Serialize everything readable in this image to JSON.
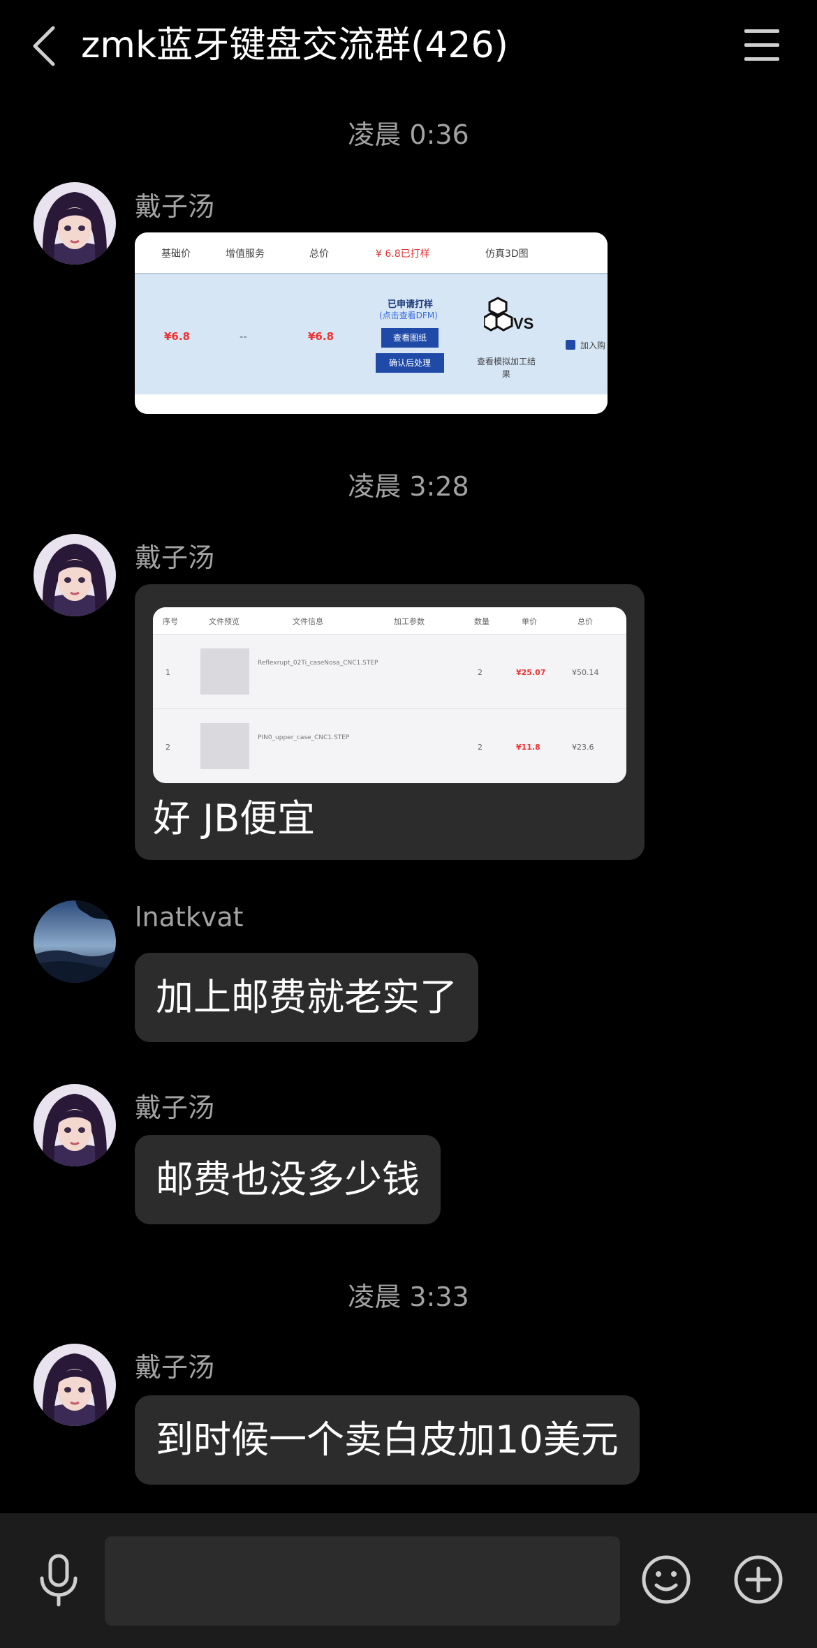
{
  "header": {
    "title": "zmk蓝牙键盘交流群(426)",
    "back_icon": "chevron-left-icon",
    "menu_icon": "hamburger-menu-icon"
  },
  "timestamps": [
    "凌晨 0:36",
    "凌晨 3:28",
    "凌晨 3:33"
  ],
  "messages": [
    {
      "sender": "戴子汤",
      "type": "image",
      "avatar": "anime-girl-avatar",
      "image_content": {
        "headers": [
          "基础价",
          "增值服务",
          "总价",
          "¥ 6.8已打样",
          "仿真3D图"
        ],
        "cells": [
          "¥6.8",
          "--",
          "¥6.8",
          "已申请打样",
          "(点击查看DFM)",
          "查看图纸",
          "确认后处理",
          "查看模拟加工结果",
          "加入购"
        ]
      }
    },
    {
      "sender": "戴子汤",
      "type": "image_with_text",
      "avatar": "anime-girl-avatar",
      "image_content": {
        "headers": [
          "序号",
          "文件预览",
          "文件信息",
          "加工参数",
          "数量",
          "单价",
          "总价"
        ],
        "rows": [
          {
            "no": "1",
            "file": "Reflexrupt_02Ti_caseNosa_CNC1.STEP",
            "qty": "2",
            "price": "¥25.07",
            "total": "¥50.14"
          },
          {
            "no": "2",
            "file": "PIN0_upper_case_CNC1.STEP",
            "qty": "2",
            "price": "¥11.8",
            "total": "¥23.6"
          }
        ]
      },
      "text": "好 JB便宜"
    },
    {
      "sender": "lnatkvat",
      "type": "text",
      "avatar": "landscape-avatar",
      "text": "加上邮费就老实了"
    },
    {
      "sender": "戴子汤",
      "type": "text",
      "avatar": "anime-girl-avatar",
      "text": "邮费也没多少钱"
    },
    {
      "sender": "戴子汤",
      "type": "text",
      "avatar": "anime-girl-avatar",
      "text": "到时候一个卖白皮加10美元"
    }
  ],
  "input_bar": {
    "voice_icon": "microphone-icon",
    "emoji_icon": "emoji-icon",
    "plus_icon": "plus-circle-icon",
    "placeholder": ""
  },
  "colors": {
    "background": "#000000",
    "bubble": "#2c2c2c",
    "secondary_text": "#a3a3a3",
    "input_bar": "#1c1c1c"
  }
}
